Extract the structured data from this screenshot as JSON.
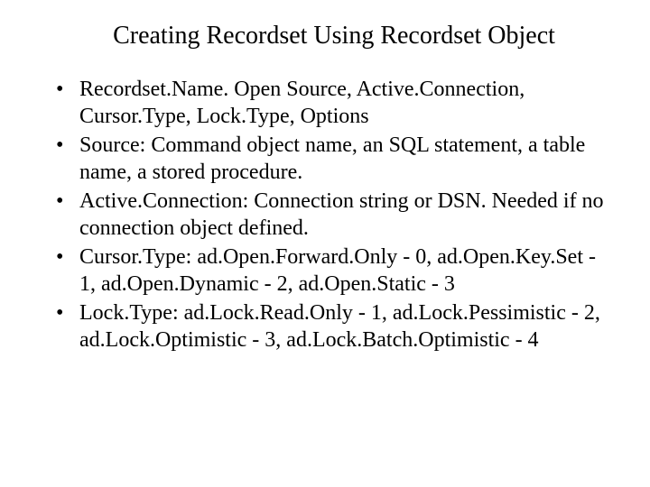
{
  "title": "Creating Recordset Using Recordset Object",
  "bullets": [
    "Recordset.Name. Open Source, Active.Connection, Cursor.Type, Lock.Type, Options",
    "Source: Command object name, an SQL statement, a table name, a stored procedure.",
    "Active.Connection: Connection string or DSN. Needed if no connection object defined.",
    "Cursor.Type: ad.Open.Forward.Only - 0, ad.Open.Key.Set - 1, ad.Open.Dynamic - 2, ad.Open.Static - 3",
    "Lock.Type: ad.Lock.Read.Only - 1, ad.Lock.Pessimistic - 2, ad.Lock.Optimistic - 3, ad.Lock.Batch.Optimistic - 4"
  ]
}
